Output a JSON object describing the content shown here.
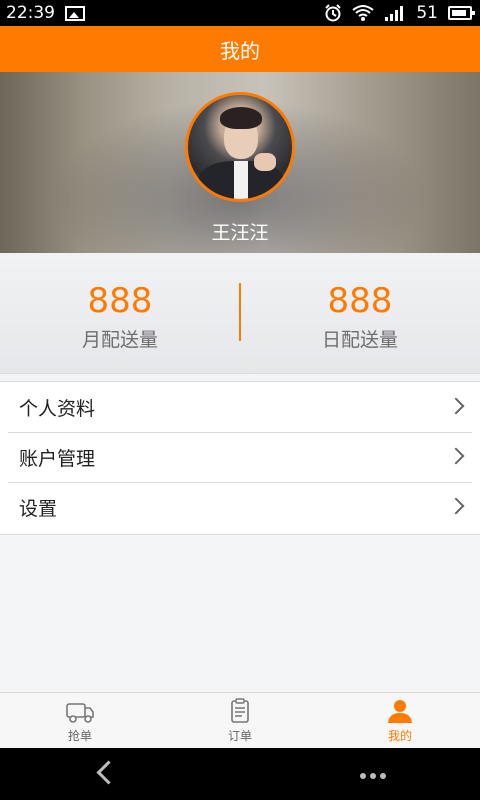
{
  "status_bar": {
    "time": "22:39",
    "battery_level": "51",
    "icons": [
      "gallery-icon",
      "alarm-icon",
      "wifi-icon",
      "signal-icon",
      "battery-icon"
    ]
  },
  "header": {
    "title": "我的"
  },
  "profile": {
    "name": "王汪汪"
  },
  "stats": {
    "monthly": {
      "value": "888",
      "label": "月配送量"
    },
    "daily": {
      "value": "888",
      "label": "日配送量"
    }
  },
  "menu": {
    "items": [
      {
        "label": "个人资料"
      },
      {
        "label": "账户管理"
      },
      {
        "label": "设置"
      }
    ]
  },
  "tabs": [
    {
      "label": "抢单",
      "icon": "delivery-truck-icon",
      "active": false
    },
    {
      "label": "订单",
      "icon": "clipboard-icon",
      "active": false
    },
    {
      "label": "我的",
      "icon": "user-icon",
      "active": true
    }
  ],
  "colors": {
    "accent": "#ff7a00",
    "tab_inactive": "#666666"
  }
}
